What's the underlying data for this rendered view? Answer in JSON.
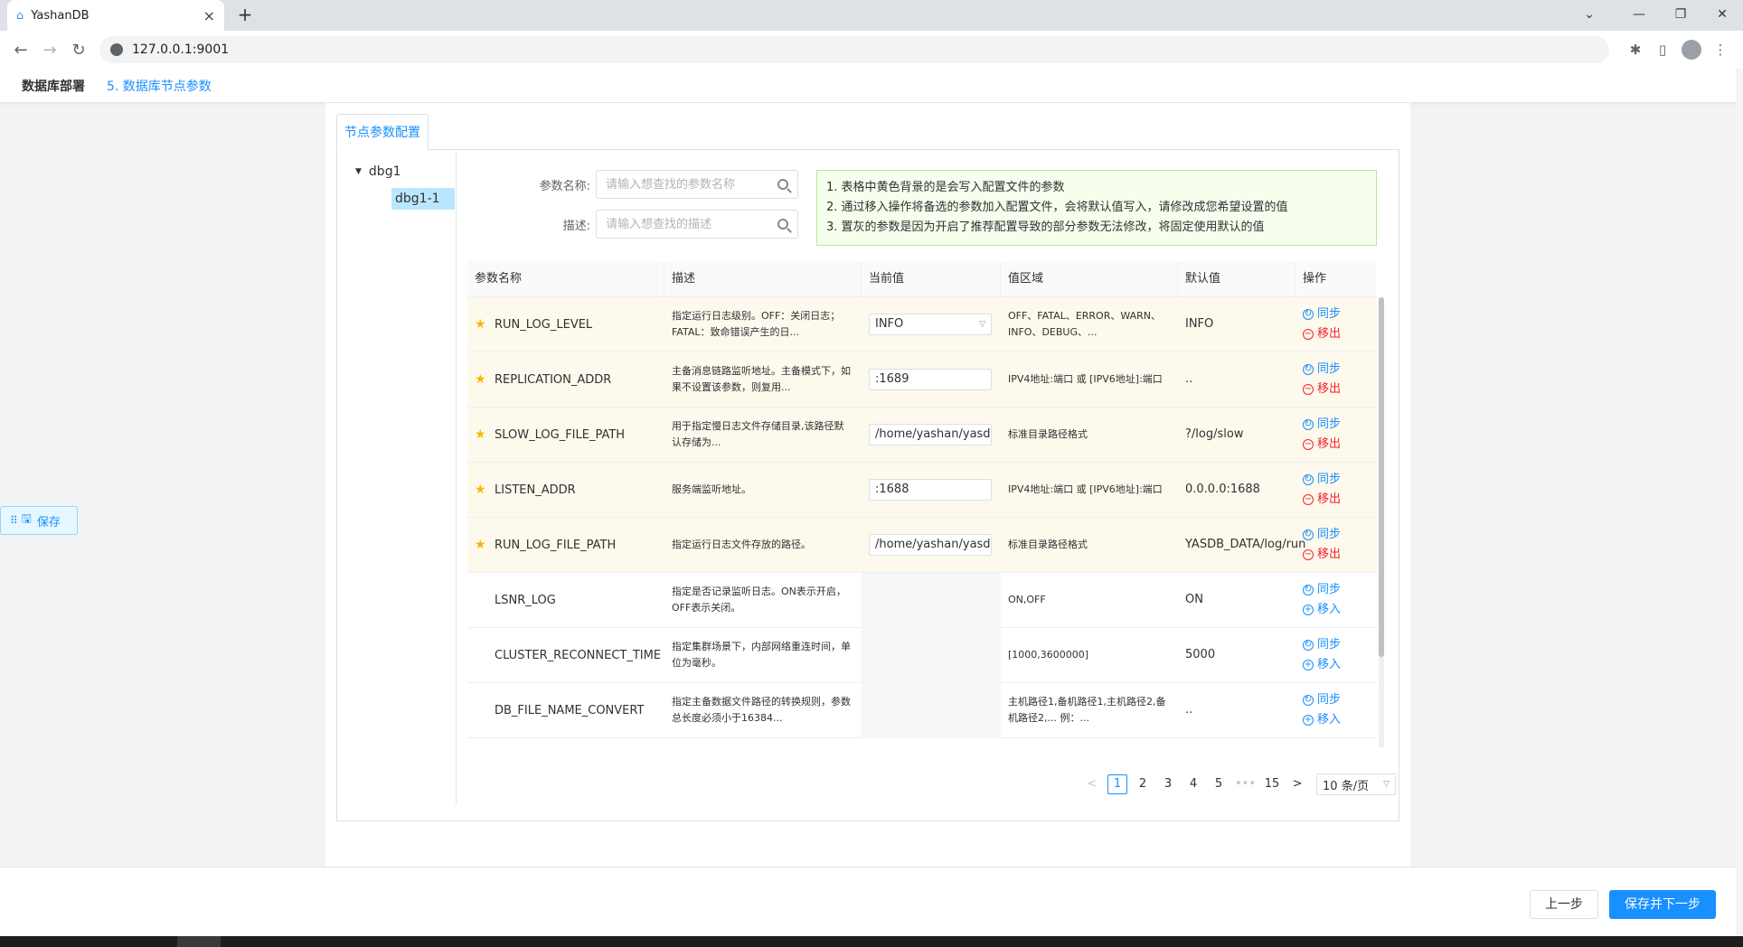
{
  "browser": {
    "tab_title": "YashanDB",
    "tab_close": "×",
    "new_tab": "+",
    "url": "127.0.0.1:9001",
    "back": "←",
    "forward": "→",
    "reload": "↻"
  },
  "header": {
    "title": "数据库部署",
    "step": "5. 数据库节点参数"
  },
  "config_tab": "节点参数配置",
  "tree": {
    "root": "dbg1",
    "child": "dbg1-1"
  },
  "filters": {
    "name_label": "参数名称:",
    "name_placeholder": "请输入想查找的参数名称",
    "desc_label": "描述:",
    "desc_placeholder": "请输入想查找的描述"
  },
  "notice": {
    "lines": [
      "1. 表格中黄色背景的是会写入配置文件的参数",
      "2. 通过移入操作将备选的参数加入配置文件，会将默认值写入，请修改成您希望设置的值",
      "3. 置灰的参数是因为开启了推荐配置导致的部分参数无法修改，将固定使用默认的值"
    ]
  },
  "table": {
    "headers": [
      "参数名称",
      "描述",
      "当前值",
      "值区域",
      "默认值",
      "操作"
    ],
    "sync_label": "同步",
    "remove_label": "移出",
    "add_label": "移入",
    "rows": [
      {
        "name": "RUN_LOG_LEVEL",
        "desc": "指定运行日志级别。OFF：关闭日志；FATAL：致命错误产生的日...",
        "current": "INFO",
        "range": "OFF、FATAL、ERROR、WARN、INFO、DEBUG、...",
        "default": "INFO"
      },
      {
        "name": "REPLICATION_ADDR",
        "desc": "主备消息链路监听地址。主备模式下，如果不设置该参数，则复用...",
        "current": ":1689",
        "range": "IPV4地址:端口 或 [IPV6地址]:端口",
        "default": ".."
      },
      {
        "name": "SLOW_LOG_FILE_PATH",
        "desc": "用于指定慢日志文件存储目录,该路径默认存储为...",
        "current": "/home/yashan/yasdb",
        "range": "标准目录路径格式",
        "default": "?/log/slow"
      },
      {
        "name": "LISTEN_ADDR",
        "desc": "服务端监听地址。",
        "current": ":1688",
        "range": "IPV4地址:端口 或 [IPV6地址]:端口",
        "default": "0.0.0.0:1688"
      },
      {
        "name": "RUN_LOG_FILE_PATH",
        "desc": "指定运行日志文件存放的路径。",
        "current": "/home/yashan/yasdb",
        "range": "标准目录路径格式",
        "default": "YASDB_DATA/log/run"
      },
      {
        "name": "LSNR_LOG",
        "desc": "指定是否记录监听日志。ON表示开启，OFF表示关闭。",
        "current": "",
        "range": "ON,OFF",
        "default": "ON"
      },
      {
        "name": "CLUSTER_RECONNECT_TIME",
        "desc": "指定集群场景下，内部网络重连时间，单位为毫秒。",
        "current": "",
        "range": "[1000,3600000]",
        "default": "5000"
      },
      {
        "name": "DB_FILE_NAME_CONVERT",
        "desc": "指定主备数据文件路径的转换规则，参数总长度必须小于16384...",
        "current": "",
        "range": "主机路径1,备机路径1,主机路径2,备机路径2,... 例：...",
        "default": ".."
      }
    ]
  },
  "pager": {
    "prev": "<",
    "pages": [
      "1",
      "2",
      "3",
      "4",
      "5"
    ],
    "ellipsis": "•••",
    "last": "15",
    "next": ">",
    "size": "10 条/页"
  },
  "float_save": "保存",
  "footer": {
    "prev": "上一步",
    "next": "保存并下一步"
  },
  "colors": {
    "accent": "#1890ff",
    "danger": "#f5222d",
    "highlight_row": "#fdf9ec",
    "notice_bg": "#f6ffed"
  }
}
